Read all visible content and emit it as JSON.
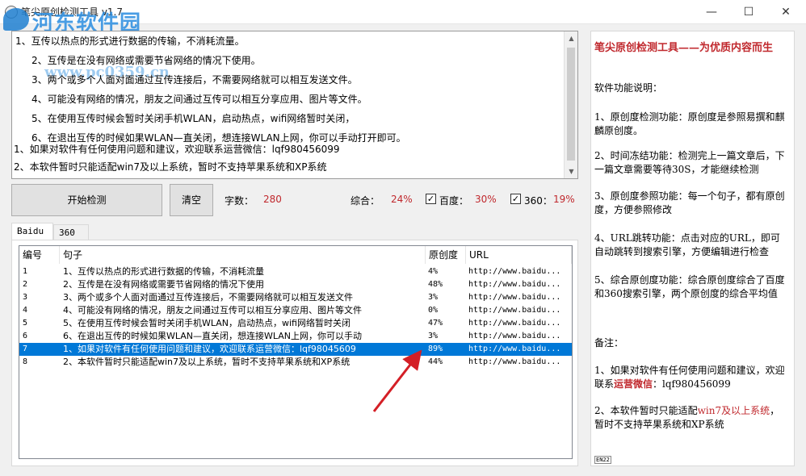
{
  "window": {
    "title": "笔尖原创检测工具 v1.7",
    "minimize": "—",
    "maximize": "☐",
    "close": "✕"
  },
  "watermark": {
    "text": "河东软件园",
    "url": "www.pc0359.cn"
  },
  "input_text": {
    "lines": [
      "1、互传以热点的形式进行数据的传输，不消耗流量。",
      "2、互传是在没有网络或需要节省网络的情况下使用。",
      "3、两个或多个人面对面通过互传连接后，不需要网络就可以相互发送文件。",
      "4、可能没有网络的情况，朋友之间通过互传可以相互分享应用、图片等文件。",
      "5、在使用互传时候会暂时关闭手机WLAN，启动热点，wifi网络暂时关闭，",
      "6、在退出互传的时候如果WLAN—直关闭，想连接WLAN上网，你可以手动打开即可。",
      "1、如果对软件有任何使用问题和建议，欢迎联系运营微信：lqf980456099",
      "2、本软件暂时只能适配win7及以上系统，暂时不支持苹果系统和XP系统"
    ]
  },
  "controls": {
    "start_button": "开始检测",
    "clear_button": "清空",
    "char_count_label": "字数：",
    "char_count": "280",
    "overall_label": "综合：",
    "overall_value": "24%",
    "baidu_label": "百度：",
    "baidu_value": "30%",
    "baidu_checked": "✓",
    "s360_label": "360：",
    "s360_value": "19%",
    "s360_checked": "✓"
  },
  "tabs": [
    "Baidu",
    "360"
  ],
  "table": {
    "headers": [
      "编号",
      "句子",
      "原创度",
      "URL"
    ],
    "rows": [
      [
        "1",
        "1、互传以热点的形式进行数据的传输，不消耗流量",
        "4%",
        "http://www.baidu..."
      ],
      [
        "2",
        "2、互传是在没有网络或需要节省网络的情况下使用",
        "48%",
        "http://www.baidu..."
      ],
      [
        "3",
        "3、两个或多个人面对面通过互传连接后，不需要网络就可以相互发送文件",
        "3%",
        "http://www.baidu..."
      ],
      [
        "4",
        "4、可能没有网络的情况，朋友之间通过互传可以相互分享应用、图片等文件",
        "0%",
        "http://www.baidu..."
      ],
      [
        "5",
        "5、在使用互传时候会暂时关闭手机WLAN，启动热点，wifi网络暂时关闭",
        "47%",
        "http://www.baidu..."
      ],
      [
        "6",
        "6、在退出互传的时候如果WLAN—直关闭，想连接WLAN上网，你可以手动",
        "3%",
        "http://www.baidu..."
      ],
      [
        "7",
        "1、如果对软件有任何使用问题和建议，欢迎联系运营微信：lqf98045609",
        "89%",
        "http://www.baidu..."
      ],
      [
        "8",
        "2、本软件暂时只能适配win7及以上系统，暂时不支持苹果系统和XP系统",
        "44%",
        "http://www.baidu..."
      ]
    ],
    "selected_row": 7
  },
  "sidebar": {
    "title": "笔尖原创检测工具——为优质内容而生",
    "features_heading": "软件功能说明：",
    "features": [
      "1、原创度检测功能：原创度是参照易撰和麒麟原创度。",
      "2、时间冻结功能：检测完上一篇文章后，下一篇文章需要等待30S，才能继续检测",
      "3、原创度参照功能：每一个句子，都有原创度，方便参照修改",
      "4、URL跳转功能：点击对应的URL，即可自动跳转到搜索引擎，方便编辑进行检查",
      "5、综合原创度功能：综合原创度综合了百度和360搜索引擎，两个原创度的综合平均值"
    ],
    "notes_heading": "备注：",
    "note1_prefix": "1、如果对软件有任何使用问题和建议，欢迎联系",
    "note1_highlight": "运营微信",
    "note1_suffix": "：lqf980456099",
    "note2_prefix": "2、本软件暂时只能适配",
    "note2_highlight": "win7及以上系统",
    "note2_suffix": "，暂时不支持苹果系统和XP系统",
    "ime_indicator": "EN22"
  },
  "colors": {
    "accent_red": "#c0282d",
    "selection_blue": "#0078d7",
    "watermark_blue": "#2a8de0"
  }
}
